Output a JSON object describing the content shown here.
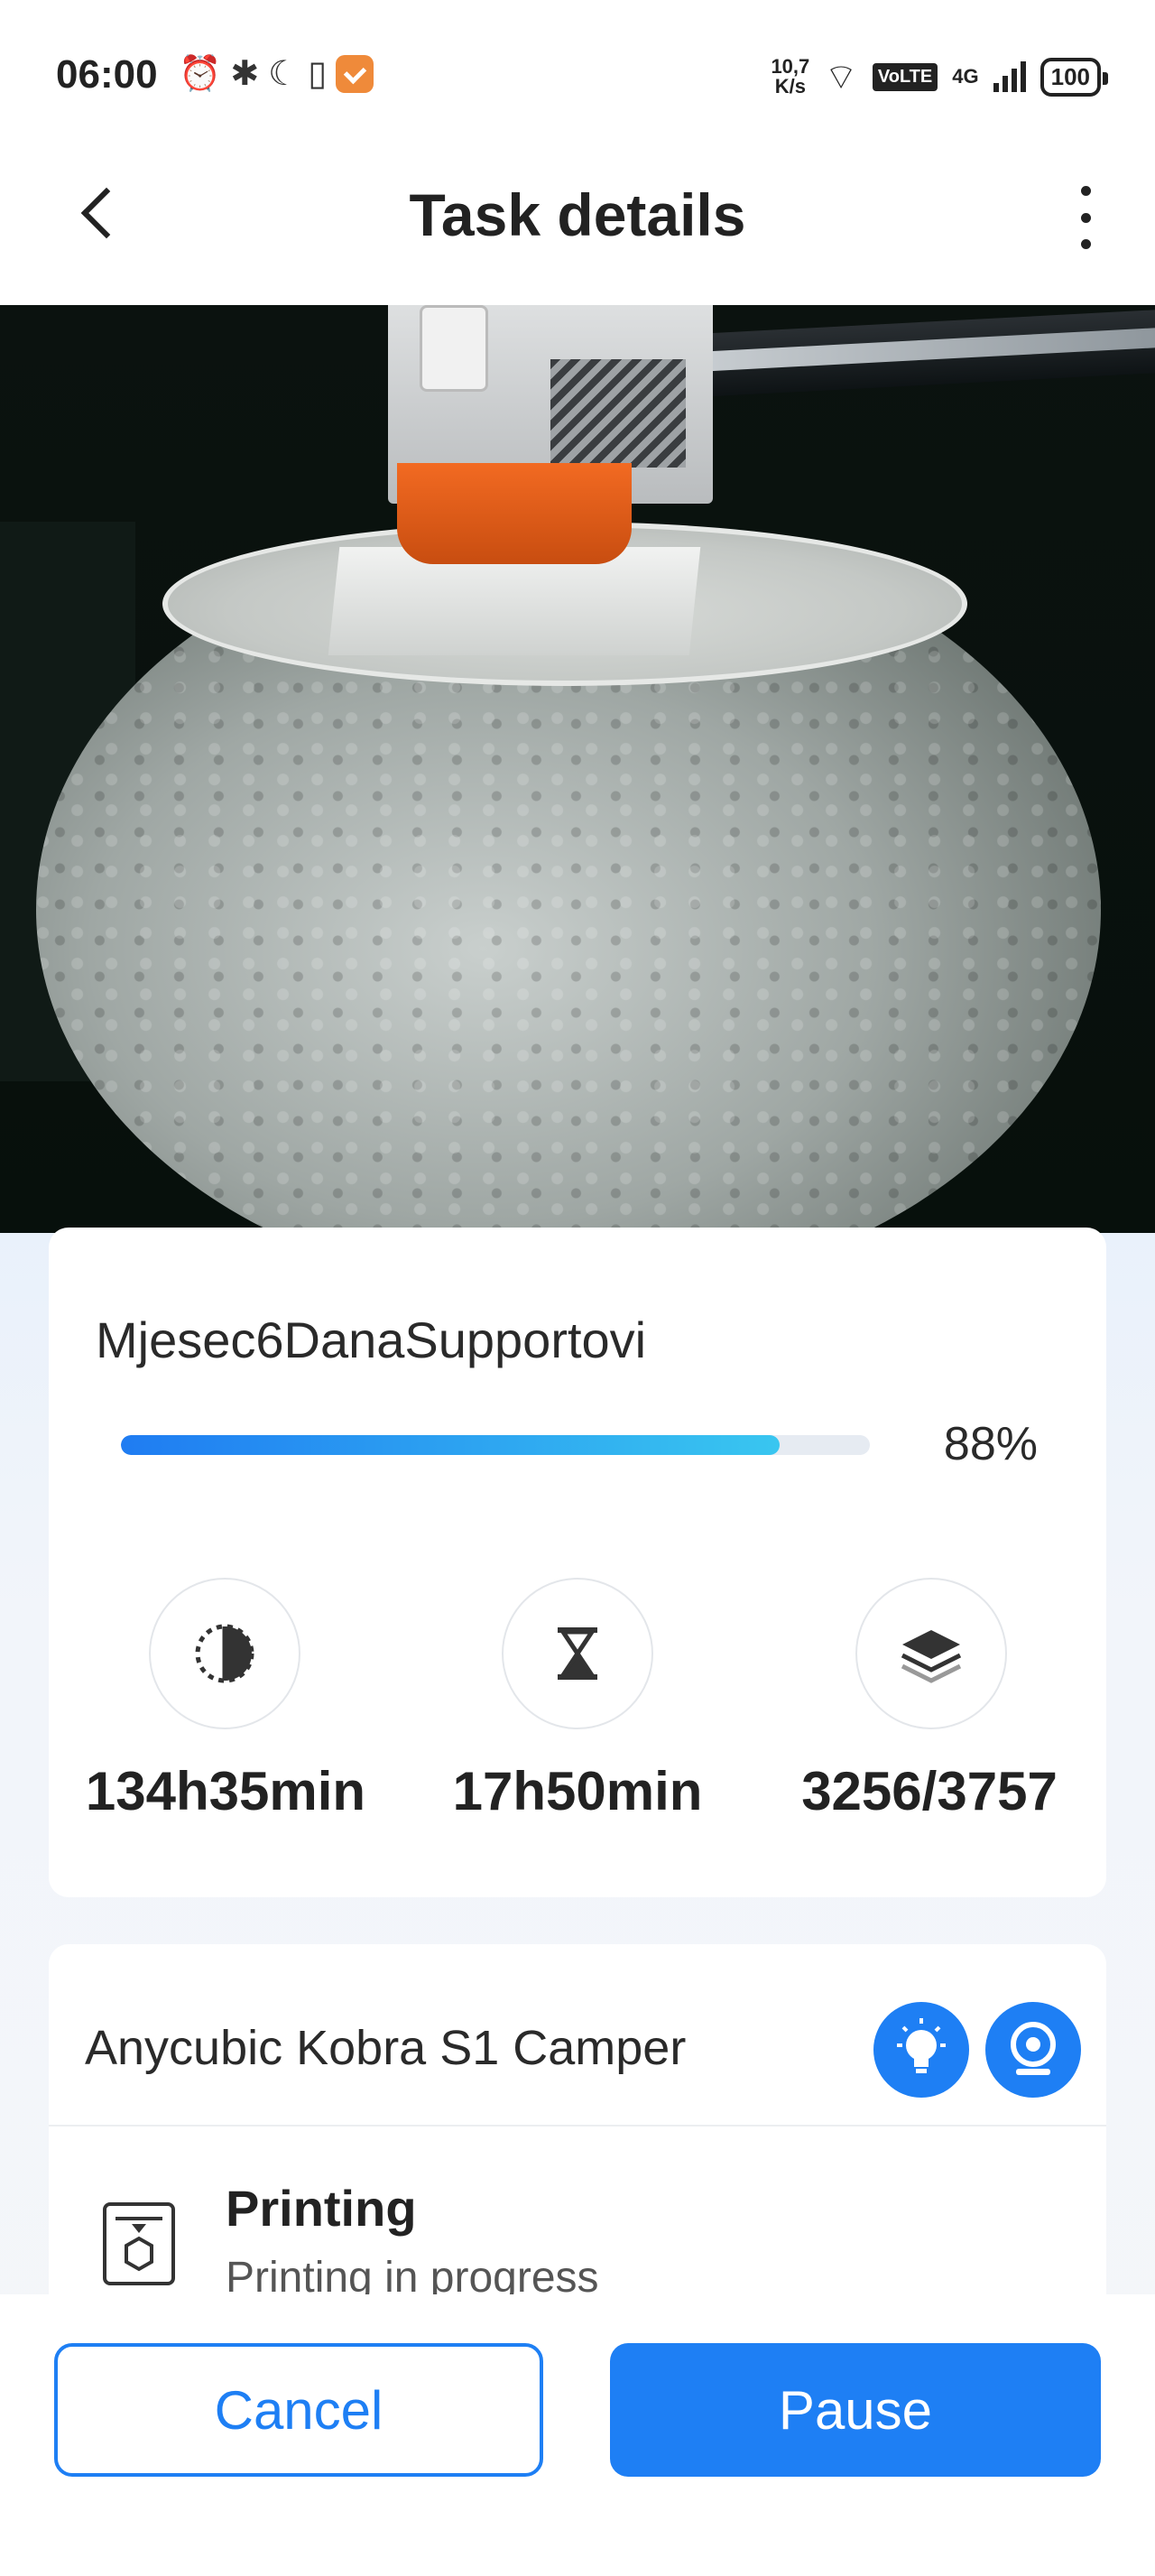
{
  "status_bar": {
    "time": "06:00",
    "net_speed_value": "10,7",
    "net_speed_unit": "K/s",
    "volte": "VoLTE",
    "network": "4G",
    "battery": "100"
  },
  "header": {
    "title": "Task details"
  },
  "task": {
    "name": "Mjesec6DanaSupportovi",
    "progress_percent": 88,
    "progress_label": "88%",
    "stats": [
      {
        "icon": "elapsed-time-icon",
        "value": "134h35min"
      },
      {
        "icon": "hourglass-icon",
        "value": "17h50min"
      },
      {
        "icon": "layers-icon",
        "value": "3256/3757"
      }
    ]
  },
  "printer": {
    "name": "Anycubic Kobra S1 Camper",
    "status_title": "Printing",
    "status_subtitle": "Printing in progress"
  },
  "actions": {
    "cancel_label": "Cancel",
    "pause_label": "Pause"
  },
  "colors": {
    "accent": "#1e7ff4",
    "progress_start": "#1f7cf2",
    "progress_end": "#39c6f0"
  }
}
